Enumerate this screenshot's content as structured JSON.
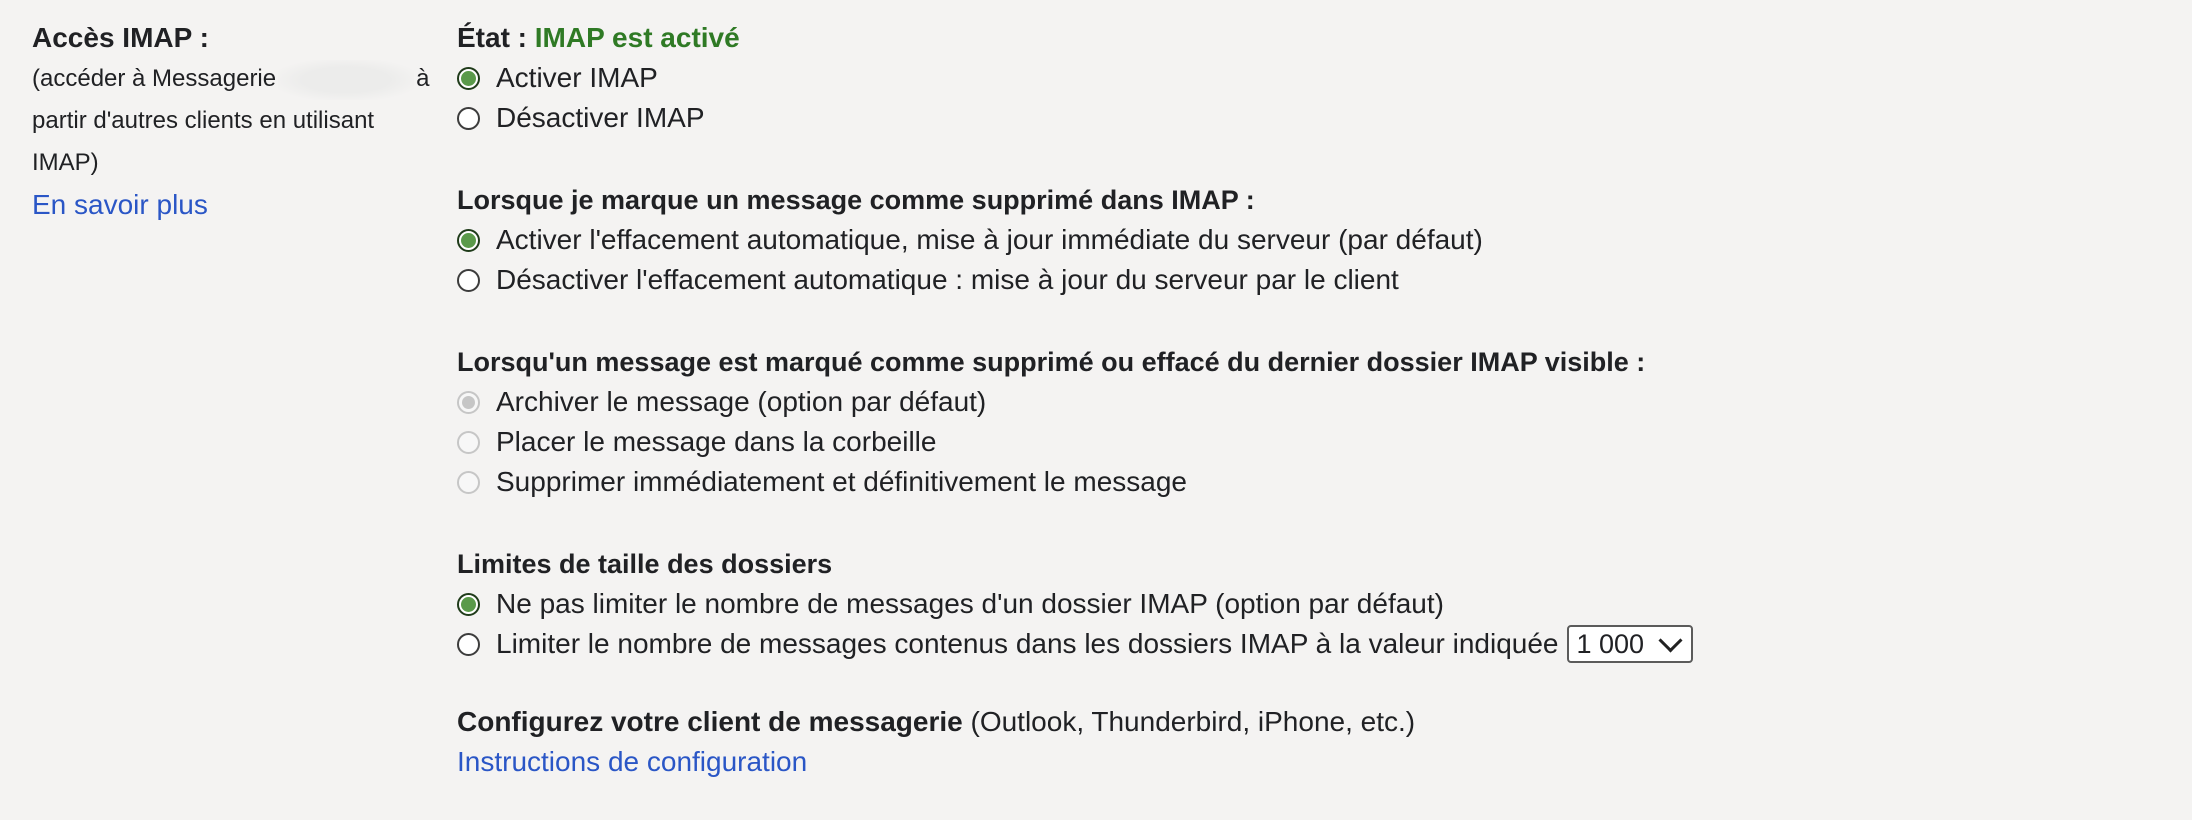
{
  "left": {
    "title": "Accès IMAP :",
    "desc_part1": "(accéder à Messagerie",
    "desc_part2": "à",
    "desc_line2": "partir d'autres clients en utilisant",
    "desc_line3": "IMAP)",
    "learn_more": "En savoir plus"
  },
  "status": {
    "label": "État : ",
    "value": "IMAP est activé",
    "value_color": "#2f7a25"
  },
  "imap_toggle": {
    "options": [
      {
        "label": "Activer IMAP",
        "checked": true
      },
      {
        "label": "Désactiver IMAP",
        "checked": false
      }
    ]
  },
  "expunge": {
    "title": "Lorsque je marque un message comme supprimé dans IMAP :",
    "options": [
      {
        "label": "Activer l'effacement automatique, mise à jour immédiate du serveur (par défaut)",
        "checked": true
      },
      {
        "label": "Désactiver l'effacement automatique : mise à jour du serveur par le client",
        "checked": false
      }
    ]
  },
  "deleted_action": {
    "title": "Lorsqu'un message est marqué comme supprimé ou effacé du dernier dossier IMAP visible :",
    "options": [
      {
        "label": "Archiver le message (option par défaut)",
        "checked": true,
        "disabled": true
      },
      {
        "label": "Placer le message dans la corbeille",
        "checked": false,
        "disabled": true
      },
      {
        "label": "Supprimer immédiatement et définitivement le message",
        "checked": false,
        "disabled": true
      }
    ]
  },
  "folder_limits": {
    "title": "Limites de taille des dossiers",
    "options": [
      {
        "label": "Ne pas limiter le nombre de messages d'un dossier IMAP (option par défaut)",
        "checked": true
      },
      {
        "label": "Limiter le nombre de messages contenus dans les dossiers IMAP à la valeur indiquée",
        "checked": false
      }
    ],
    "limit_value": "1 000"
  },
  "configure": {
    "title_bold": "Configurez votre client de messagerie",
    "title_rest": " (Outlook, Thunderbird, iPhone, etc.)",
    "link": "Instructions de configuration"
  },
  "colors": {
    "background": "#f4f3f2",
    "link": "#2a56c6",
    "radio_checked": "#5a9a4a"
  }
}
